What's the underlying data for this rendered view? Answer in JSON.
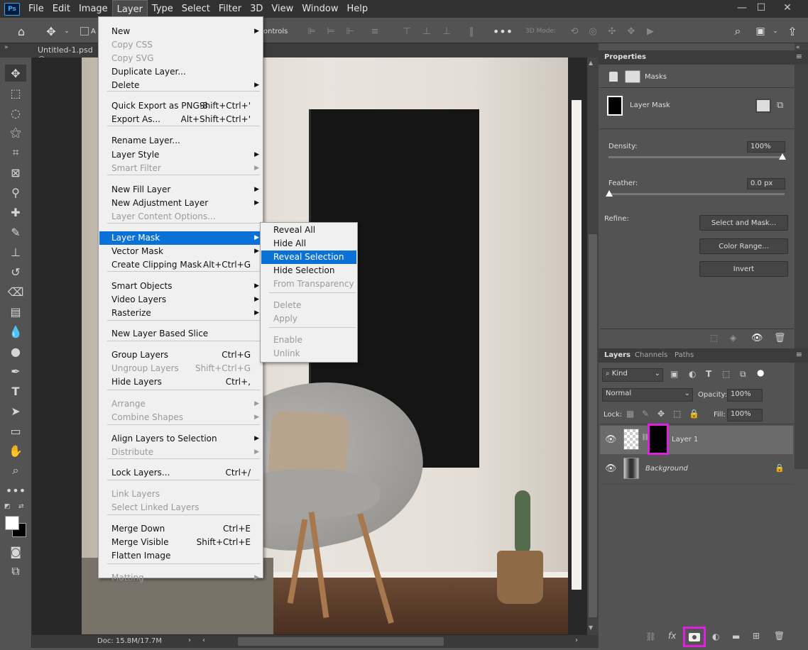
{
  "menubar": {
    "items": [
      "File",
      "Edit",
      "Image",
      "Layer",
      "Type",
      "Select",
      "Filter",
      "3D",
      "View",
      "Window",
      "Help"
    ],
    "logo": "Ps"
  },
  "optbar": {
    "auto_select": "A",
    "controls": "ontrols",
    "mode3d": "3D Mode:"
  },
  "document": {
    "tab_title": "Untitled-1.psd @",
    "status": "Doc: 15.8M/17.7M"
  },
  "layer_menu": {
    "items": [
      {
        "label": "New",
        "shortcut": "",
        "arrow": true,
        "disabled": false
      },
      {
        "label": "Copy CSS",
        "shortcut": "",
        "arrow": false,
        "disabled": true
      },
      {
        "label": "Copy SVG",
        "shortcut": "",
        "arrow": false,
        "disabled": true
      },
      {
        "label": "Duplicate Layer...",
        "shortcut": "",
        "arrow": false,
        "disabled": false
      },
      {
        "label": "Delete",
        "shortcut": "",
        "arrow": true,
        "disabled": false
      },
      {
        "label": "Quick Export as PNG-8",
        "shortcut": "Shift+Ctrl+'",
        "arrow": false,
        "disabled": false
      },
      {
        "label": "Export As...",
        "shortcut": "Alt+Shift+Ctrl+'",
        "arrow": false,
        "disabled": false
      },
      {
        "label": "Rename Layer...",
        "shortcut": "",
        "arrow": false,
        "disabled": false
      },
      {
        "label": "Layer Style",
        "shortcut": "",
        "arrow": true,
        "disabled": false
      },
      {
        "label": "Smart Filter",
        "shortcut": "",
        "arrow": true,
        "disabled": true
      },
      {
        "label": "New Fill Layer",
        "shortcut": "",
        "arrow": true,
        "disabled": false
      },
      {
        "label": "New Adjustment Layer",
        "shortcut": "",
        "arrow": true,
        "disabled": false
      },
      {
        "label": "Layer Content Options...",
        "shortcut": "",
        "arrow": false,
        "disabled": true
      },
      {
        "label": "Layer Mask",
        "shortcut": "",
        "arrow": true,
        "disabled": false,
        "selected": true
      },
      {
        "label": "Vector Mask",
        "shortcut": "",
        "arrow": true,
        "disabled": false
      },
      {
        "label": "Create Clipping Mask",
        "shortcut": "Alt+Ctrl+G",
        "arrow": false,
        "disabled": false
      },
      {
        "label": "Smart Objects",
        "shortcut": "",
        "arrow": true,
        "disabled": false
      },
      {
        "label": "Video Layers",
        "shortcut": "",
        "arrow": true,
        "disabled": false
      },
      {
        "label": "Rasterize",
        "shortcut": "",
        "arrow": true,
        "disabled": false
      },
      {
        "label": "New Layer Based Slice",
        "shortcut": "",
        "arrow": false,
        "disabled": false
      },
      {
        "label": "Group Layers",
        "shortcut": "Ctrl+G",
        "arrow": false,
        "disabled": false
      },
      {
        "label": "Ungroup Layers",
        "shortcut": "Shift+Ctrl+G",
        "arrow": false,
        "disabled": true
      },
      {
        "label": "Hide Layers",
        "shortcut": "Ctrl+,",
        "arrow": false,
        "disabled": false
      },
      {
        "label": "Arrange",
        "shortcut": "",
        "arrow": true,
        "disabled": true
      },
      {
        "label": "Combine Shapes",
        "shortcut": "",
        "arrow": true,
        "disabled": true
      },
      {
        "label": "Align Layers to Selection",
        "shortcut": "",
        "arrow": true,
        "disabled": false
      },
      {
        "label": "Distribute",
        "shortcut": "",
        "arrow": true,
        "disabled": true
      },
      {
        "label": "Lock Layers...",
        "shortcut": "Ctrl+/",
        "arrow": false,
        "disabled": false
      },
      {
        "label": "Link Layers",
        "shortcut": "",
        "arrow": false,
        "disabled": true
      },
      {
        "label": "Select Linked Layers",
        "shortcut": "",
        "arrow": false,
        "disabled": true
      },
      {
        "label": "Merge Down",
        "shortcut": "Ctrl+E",
        "arrow": false,
        "disabled": false
      },
      {
        "label": "Merge Visible",
        "shortcut": "Shift+Ctrl+E",
        "arrow": false,
        "disabled": false
      },
      {
        "label": "Flatten Image",
        "shortcut": "",
        "arrow": false,
        "disabled": false
      },
      {
        "label": "Matting",
        "shortcut": "",
        "arrow": true,
        "disabled": true
      }
    ]
  },
  "layer_mask_submenu": {
    "items": [
      {
        "label": "Reveal All",
        "disabled": false
      },
      {
        "label": "Hide All",
        "disabled": false
      },
      {
        "label": "Reveal Selection",
        "disabled": false,
        "selected": true
      },
      {
        "label": "Hide Selection",
        "disabled": false
      },
      {
        "label": "From Transparency",
        "disabled": true
      },
      {
        "label": "Delete",
        "disabled": true
      },
      {
        "label": "Apply",
        "disabled": true
      },
      {
        "label": "Enable",
        "disabled": true
      },
      {
        "label": "Unlink",
        "disabled": true
      }
    ]
  },
  "properties": {
    "title": "Properties",
    "masks_label": "Masks",
    "layer_mask_label": "Layer Mask",
    "density_label": "Density:",
    "density_value": "100%",
    "density_level": 1.0,
    "feather_label": "Feather:",
    "feather_value": "0.0 px",
    "feather_level": 0.0,
    "refine_label": "Refine:",
    "select_and_mask": "Select and Mask...",
    "color_range": "Color Range...",
    "invert": "Invert"
  },
  "layers_panel": {
    "tabs": [
      "Layers",
      "Channels",
      "Paths"
    ],
    "kind_label": "Kind",
    "blend_mode": "Normal",
    "opacity_label": "Opacity:",
    "opacity_value": "100%",
    "lock_label": "Lock:",
    "fill_label": "Fill:",
    "fill_value": "100%",
    "layers": [
      {
        "name": "Layer 1",
        "selected": true
      },
      {
        "name": "Background",
        "selected": false
      }
    ]
  }
}
